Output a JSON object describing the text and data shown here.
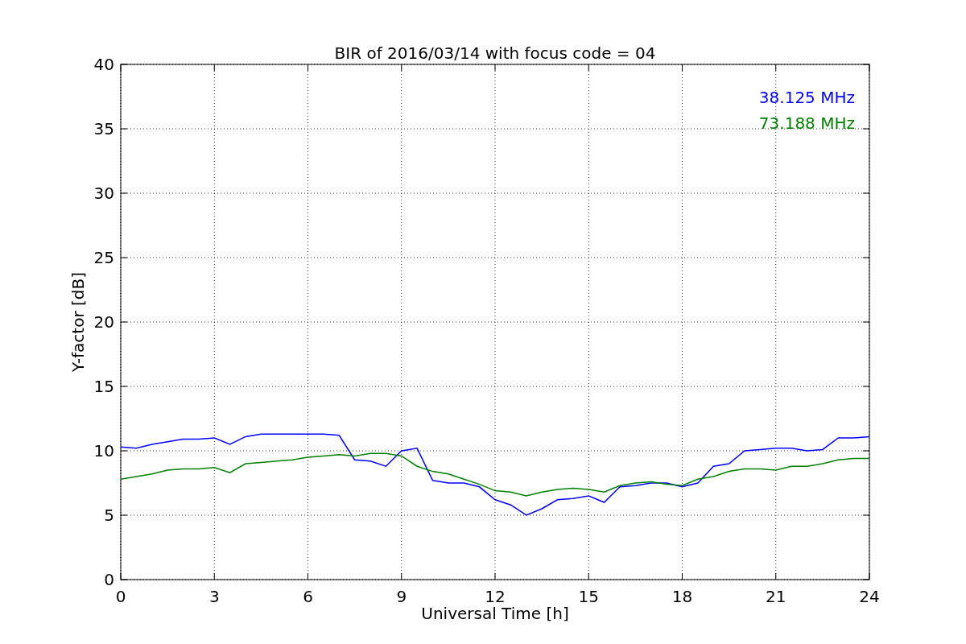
{
  "figure": {
    "chart_data": {
      "type": "line",
      "title": "BIR of 2016/03/14 with focus code = 04",
      "xlabel": "Universal Time [h]",
      "ylabel": "Y-factor [dB]",
      "x": [
        0,
        0.5,
        1,
        1.5,
        2,
        2.5,
        3,
        3.5,
        4,
        4.5,
        5,
        5.5,
        6,
        6.5,
        7,
        7.5,
        8,
        8.5,
        9,
        9.5,
        10,
        10.5,
        11,
        11.5,
        12,
        12.5,
        13,
        13.5,
        14,
        14.5,
        15,
        15.5,
        16,
        16.5,
        17,
        17.5,
        18,
        18.5,
        19,
        19.5,
        20,
        20.5,
        21,
        21.5,
        22,
        22.5,
        23,
        23.5,
        24
      ],
      "series": [
        {
          "name": "38.125 MHz",
          "color": "#0000ff",
          "values": [
            10.3,
            10.2,
            10.5,
            10.7,
            10.9,
            10.9,
            11.0,
            10.5,
            11.1,
            11.3,
            11.3,
            11.3,
            11.3,
            11.3,
            11.2,
            9.3,
            9.2,
            8.8,
            10.0,
            10.2,
            7.7,
            7.5,
            7.5,
            7.2,
            6.2,
            5.8,
            5.0,
            5.5,
            6.2,
            6.3,
            6.5,
            6.0,
            7.2,
            7.3,
            7.5,
            7.5,
            7.2,
            7.5,
            8.8,
            9.0,
            10.0,
            10.1,
            10.2,
            10.2,
            10.0,
            10.1,
            11.0,
            11.0,
            11.1
          ]
        },
        {
          "name": "73.188 MHz",
          "color": "#008000",
          "values": [
            7.8,
            8.0,
            8.2,
            8.5,
            8.6,
            8.6,
            8.7,
            8.3,
            9.0,
            9.1,
            9.2,
            9.3,
            9.5,
            9.6,
            9.7,
            9.6,
            9.8,
            9.8,
            9.6,
            8.8,
            8.4,
            8.2,
            7.8,
            7.4,
            6.9,
            6.8,
            6.5,
            6.8,
            7.0,
            7.1,
            7.0,
            6.8,
            7.3,
            7.5,
            7.6,
            7.4,
            7.3,
            7.8,
            8.0,
            8.4,
            8.6,
            8.6,
            8.5,
            8.8,
            8.8,
            9.0,
            9.3,
            9.4,
            9.4
          ]
        }
      ],
      "grid": true,
      "xlim": [
        0,
        24
      ],
      "ylim": [
        0,
        40
      ],
      "xticks": [
        0,
        3,
        6,
        9,
        12,
        15,
        18,
        21,
        24
      ],
      "yticks": [
        0,
        5,
        10,
        15,
        20,
        25,
        30,
        35,
        40
      ]
    }
  }
}
